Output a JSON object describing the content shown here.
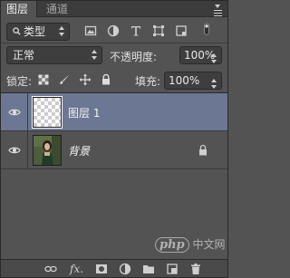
{
  "tabs": {
    "layers": "图层",
    "close": "×",
    "channels": "通道"
  },
  "filter": {
    "label": "类型",
    "icons": [
      "image-filter-icon",
      "adjustment-filter-icon",
      "text-filter-icon",
      "shape-filter-icon",
      "smart-object-filter-icon",
      "toggle-filter-icon"
    ]
  },
  "blend": {
    "mode": "正常",
    "opacity_label": "不透明度:",
    "opacity_value": "100%"
  },
  "lock": {
    "label": "锁定:",
    "icons": [
      "lock-transparent-icon",
      "lock-image-icon",
      "lock-position-icon",
      "lock-all-icon"
    ],
    "fill_label": "填充:",
    "fill_value": "100%"
  },
  "layers": [
    {
      "name": "图层 1",
      "selected": true,
      "visible": true
    },
    {
      "name": "背景",
      "selected": false,
      "visible": true,
      "locked": true
    }
  ],
  "bottom_icons": [
    "link-icon",
    "fx-icon",
    "mask-icon",
    "adjustment-icon",
    "group-icon",
    "new-layer-icon",
    "trash-icon"
  ],
  "bottom_fx": "fx.",
  "watermark": {
    "logo": "php",
    "text": "中文网"
  },
  "colors": {
    "panel": "#535353",
    "selected": "#6c7893",
    "tabbar": "#3c3c3c"
  }
}
